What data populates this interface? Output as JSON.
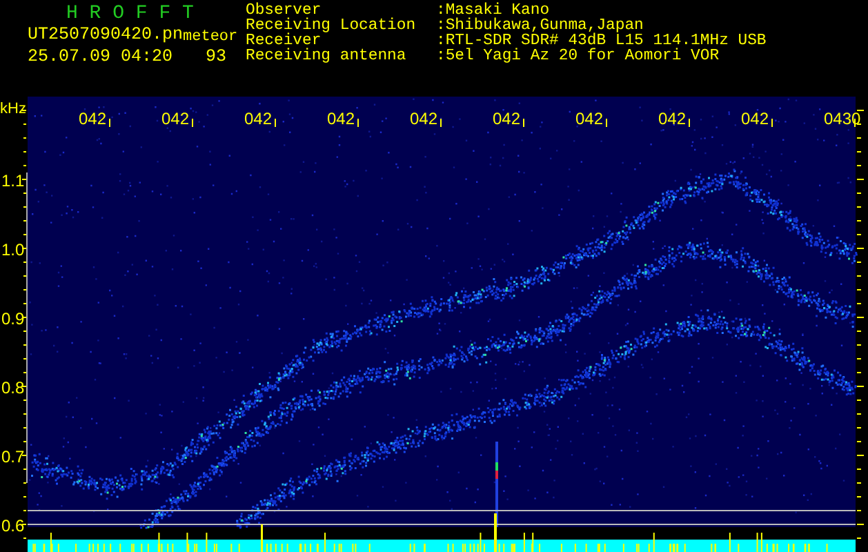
{
  "header": {
    "title": "H R O F F T",
    "filename": "UT2507090420.pn",
    "tag": "meteor",
    "datetime": "25.07.09 04:20",
    "number": "93"
  },
  "info": [
    {
      "label": "Observer",
      "value": ":Masaki Kano"
    },
    {
      "label": "Receiving Location",
      "value": ":Shibukawa,Gunma,Japan"
    },
    {
      "label": "Receiver",
      "value": ":RTL-SDR SDR# 43dB L15 114.1MHz USB"
    },
    {
      "label": "Receiving antenna",
      "value": ":5el Yagi Az 20 for Aomori VOR"
    }
  ],
  "plot": {
    "unit": "kHz",
    "y_labels": [
      "1.1",
      "1.0",
      "0.9",
      "0.8",
      "0.7",
      "0.6"
    ],
    "time_labels": [
      "042",
      "042",
      "042",
      "042",
      "042",
      "042",
      "042",
      "042",
      "042",
      "0430"
    ]
  }
}
